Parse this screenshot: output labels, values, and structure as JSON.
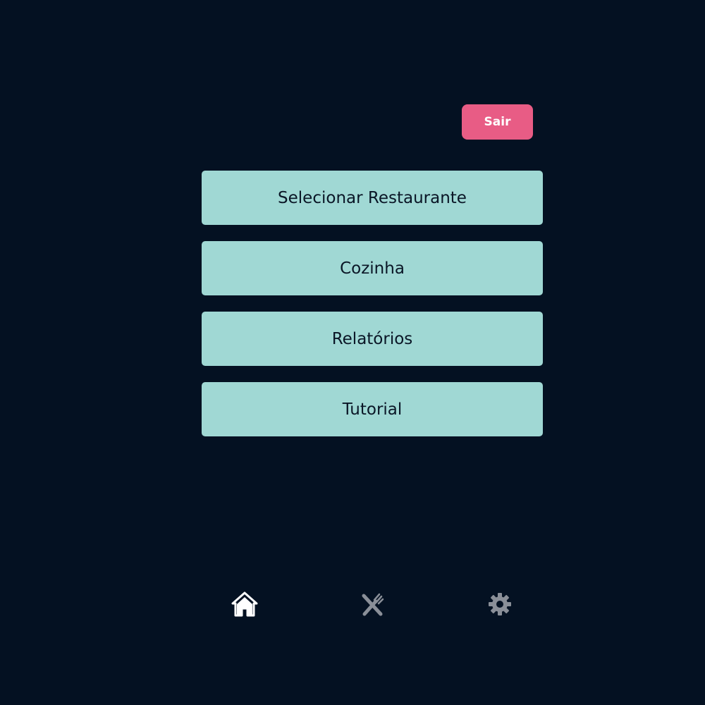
{
  "header": {
    "logout_label": "Sair"
  },
  "menu": {
    "items": [
      {
        "label": "Selecionar Restaurante"
      },
      {
        "label": "Cozinha"
      },
      {
        "label": "Relatórios"
      },
      {
        "label": "Tutorial"
      }
    ]
  },
  "bottom_nav": {
    "items": [
      {
        "icon": "home-icon",
        "active": true
      },
      {
        "icon": "utensils-icon",
        "active": false
      },
      {
        "icon": "gear-icon",
        "active": false
      }
    ]
  },
  "colors": {
    "background": "#041122",
    "logout_button": "#e85c85",
    "menu_button": "#a0d8d4",
    "nav_active": "#ffffff",
    "nav_inactive": "#8a8f98"
  }
}
